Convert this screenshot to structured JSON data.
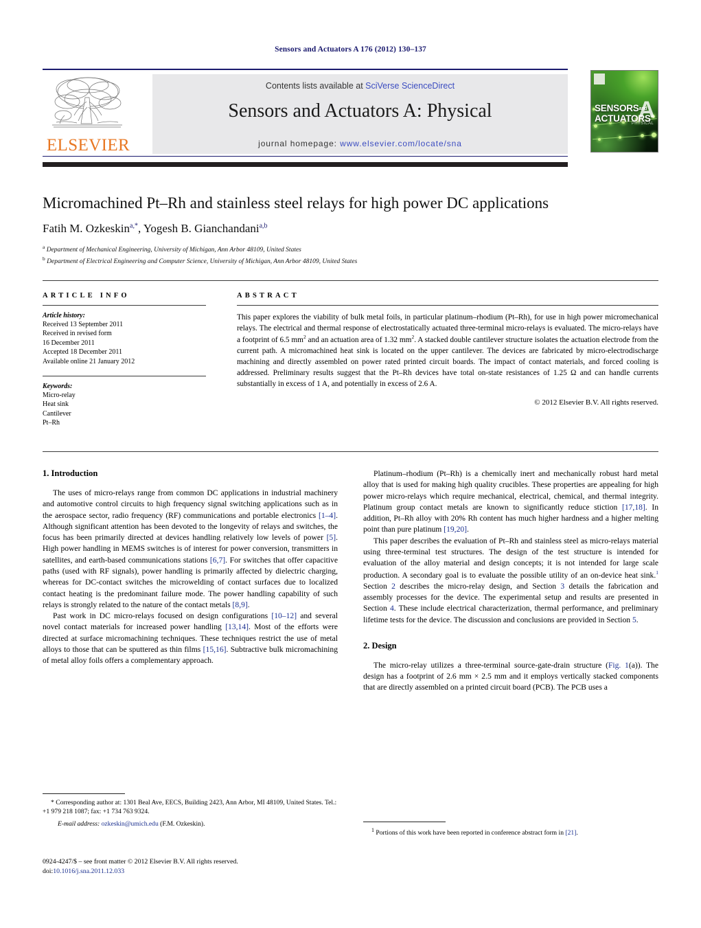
{
  "running_head": "Sensors and Actuators A 176 (2012) 130–137",
  "masthead": {
    "contents_prefix": "Contents lists available at ",
    "contents_link": "SciVerse ScienceDirect",
    "journal_title": "Sensors and Actuators A: Physical",
    "homepage_prefix": "journal homepage: ",
    "homepage_url": "www.elsevier.com/locate/sna",
    "publisher_logo_text": "ELSEVIER",
    "cover": {
      "line1": "SENSORS",
      "and": "and",
      "line2": "ACTUATORS",
      "letter": "A",
      "subtitle": "PHYSICAL"
    }
  },
  "title_block": {
    "title": "Micromachined Pt–Rh and stainless steel relays for high power DC applications",
    "authors_part1": "Fatih M. Ozkeskin",
    "authors_sup1": "a,*",
    "authors_part2": ", Yogesh B. Gianchandani",
    "authors_sup2": "a,b",
    "affiliation_a_marker": "a",
    "affiliation_a": "Department of Mechanical Engineering, University of Michigan, Ann Arbor 48109, United States",
    "affiliation_b_marker": "b",
    "affiliation_b": "Department of Electrical Engineering and Computer Science, University of Michigan, Ann Arbor 48109, United States"
  },
  "article_info": {
    "heading": "ARTICLE INFO",
    "history_label": "Article history:",
    "history": [
      "Received 13 September 2011",
      "Received in revised form",
      "16 December 2011",
      "Accepted 18 December 2011",
      "Available online 21 January 2012"
    ],
    "keywords_label": "Keywords:",
    "keywords": [
      "Micro-relay",
      "Heat sink",
      "Cantilever",
      "Pt–Rh"
    ]
  },
  "abstract": {
    "heading": "ABSTRACT",
    "text_p1": "This paper explores the viability of bulk metal foils, in particular platinum–rhodium (Pt–Rh), for use in high power micromechanical relays. The electrical and thermal response of electrostatically actuated three-terminal micro-relays is evaluated. The micro-relays have a footprint of 6.5 mm",
    "sup1": "2",
    "text_p2": " and an actuation area of 1.32 mm",
    "sup2": "2",
    "text_p3": ". A stacked double cantilever structure isolates the actuation electrode from the current path. A micromachined heat sink is located on the upper cantilever. The devices are fabricated by micro-electrodischarge machining and directly assembled on power rated printed circuit boards. The impact of contact materials, and forced cooling is addressed. Preliminary results suggest that the Pt–Rh devices have total on-state resistances of 1.25 Ω and can handle currents substantially in excess of 1 A, and potentially in excess of 2.6 A.",
    "copyright": "© 2012 Elsevier B.V. All rights reserved."
  },
  "body": {
    "section1_heading": "1.  Introduction",
    "p1_a": "The uses of micro-relays range from common DC applications in industrial machinery and automotive control circuits to high frequency signal switching applications such as in the aerospace sector, radio frequency (RF) communications and portable electronics ",
    "p1_ref1": "[1–4]",
    "p1_b": ". Although significant attention has been devoted to the longevity of relays and switches, the focus has been primarily directed at devices handling relatively low levels of power ",
    "p1_ref2": "[5]",
    "p1_c": ". High power handling in MEMS switches is of interest for power conversion, transmitters in satellites, and earth-based communications stations ",
    "p1_ref3": "[6,7]",
    "p1_d": ". For switches that offer capacitive paths (used with RF signals), power handling is primarily affected by dielectric charging, whereas for DC-contact switches the microwelding of contact surfaces due to localized contact heating is the predominant failure mode. The power handling capability of such relays is strongly related to the nature of the contact metals ",
    "p1_ref4": "[8,9]",
    "p1_e": ".",
    "p2_a": "Past work in DC micro-relays focused on design configurations ",
    "p2_ref1": "[10–12]",
    "p2_b": " and several novel contact materials for increased power handling ",
    "p2_ref2": "[13,14]",
    "p2_c": ". Most of the efforts were directed at surface micromachining techniques. These techniques restrict the use of metal alloys to those that can be sputtered as thin films ",
    "p2_ref3": "[15,16]",
    "p2_d": ". Subtractive bulk micromachining of metal alloy foils offers a complementary approach.",
    "p3_a": "Platinum–rhodium (Pt–Rh) is a chemically inert and mechanically robust hard metal alloy that is used for making high quality crucibles. These properties are appealing for high power micro-relays which require mechanical, electrical, chemical, and thermal integrity. Platinum group contact metals are known to significantly reduce stiction ",
    "p3_ref1": "[17,18]",
    "p3_b": ". In addition, Pt–Rh alloy with 20% Rh content has much higher hardness and a higher melting point than pure platinum ",
    "p3_ref2": "[19,20]",
    "p3_c": ".",
    "p4_a": "This paper describes the evaluation of Pt–Rh and stainless steel as micro-relays material using three-terminal test structures. The design of the test structure is intended for evaluation of the alloy material and design concepts; it is not intended for large scale production. A secondary goal is to evaluate the possible utility of an on-device heat sink.",
    "p4_fnmark": "1",
    "p4_b": " Section ",
    "p4_ref_sec2": "2",
    "p4_c": " describes the micro-relay design, and Section ",
    "p4_ref_sec3": "3",
    "p4_d": " details the fabrication and assembly processes for the device. The experimental setup and results are presented in Section ",
    "p4_ref_sec4": "4",
    "p4_e": ". These include electrical characterization, thermal performance, and preliminary lifetime tests for the device. The discussion and conclusions are provided in Section ",
    "p4_ref_sec5": "5",
    "p4_f": ".",
    "section2_heading": "2.  Design",
    "p5_a": "The micro-relay utilizes a three-terminal source-gate-drain structure (",
    "p5_figref": "Fig. 1",
    "p5_b": "(a)). The design has a footprint of 2.6 mm × 2.5 mm and it employs vertically stacked components that are directly assembled on a printed circuit board (PCB). The PCB uses a"
  },
  "footnotes": {
    "corresponding_marker": "*",
    "corresponding_text": "Corresponding author at: 1301 Beal Ave, EECS, Building 2423, Ann Arbor, MI 48109, United States. Tel.: +1 979 218 1087; fax: +1 734 763 9324.",
    "email_label": "E-mail address:",
    "email": "ozkeskin@umich.edu",
    "email_suffix": " (F.M. Ozkeskin).",
    "right_marker": "1",
    "right_text_a": "Portions of this work have been reported in conference abstract form in ",
    "right_ref": "[21]",
    "right_text_b": "."
  },
  "issn": {
    "line1": "0924-4247/$ – see front matter © 2012 Elsevier B.V. All rights reserved.",
    "doi_label": "doi:",
    "doi_value": "10.1016/j.sna.2011.12.033"
  },
  "colors": {
    "link_blue": "#3b4cc0",
    "ref_blue": "#1a2f8f",
    "elsevier_orange": "#e87722",
    "masthead_gray": "#e8e8ea",
    "dark_bar": "#231f20"
  }
}
